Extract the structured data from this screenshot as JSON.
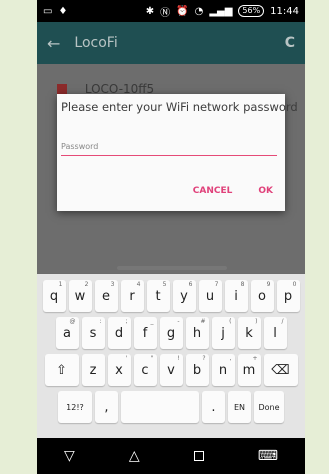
{
  "status_bar": {
    "battery": "56%",
    "time": "11:44"
  },
  "app": {
    "title": "LocoFi",
    "list_item": "LOCO-10ff5"
  },
  "dialog": {
    "title": "Please enter your WiFi network password",
    "password_placeholder": "Password",
    "cancel_label": "CANCEL",
    "ok_label": "OK"
  },
  "keyboard": {
    "row1": [
      {
        "k": "q",
        "s": "1"
      },
      {
        "k": "w",
        "s": "2"
      },
      {
        "k": "e",
        "s": "3"
      },
      {
        "k": "r",
        "s": "4"
      },
      {
        "k": "t",
        "s": "5"
      },
      {
        "k": "y",
        "s": "6"
      },
      {
        "k": "u",
        "s": "7"
      },
      {
        "k": "i",
        "s": "8"
      },
      {
        "k": "o",
        "s": "9"
      },
      {
        "k": "p",
        "s": "0"
      }
    ],
    "row2": [
      {
        "k": "a",
        "s": "@"
      },
      {
        "k": "s",
        "s": ":"
      },
      {
        "k": "d",
        "s": ";"
      },
      {
        "k": "f",
        "s": "_"
      },
      {
        "k": "g",
        "s": "-"
      },
      {
        "k": "h",
        "s": "#"
      },
      {
        "k": "j",
        "s": "("
      },
      {
        "k": "k",
        "s": ")"
      },
      {
        "k": "l",
        "s": "/"
      }
    ],
    "row3": [
      {
        "k": "z",
        "s": ""
      },
      {
        "k": "x",
        "s": "'"
      },
      {
        "k": "c",
        "s": "\""
      },
      {
        "k": "v",
        "s": "!"
      },
      {
        "k": "b",
        "s": "?"
      },
      {
        "k": "n",
        "s": ","
      },
      {
        "k": "m",
        "s": "+"
      }
    ],
    "sym_label": "12!?",
    "comma": ",",
    "period": ".",
    "lang_label": "EN",
    "done_label": "Done"
  },
  "colors": {
    "accent": "#e0417a",
    "appbar": "#1f4f52"
  }
}
